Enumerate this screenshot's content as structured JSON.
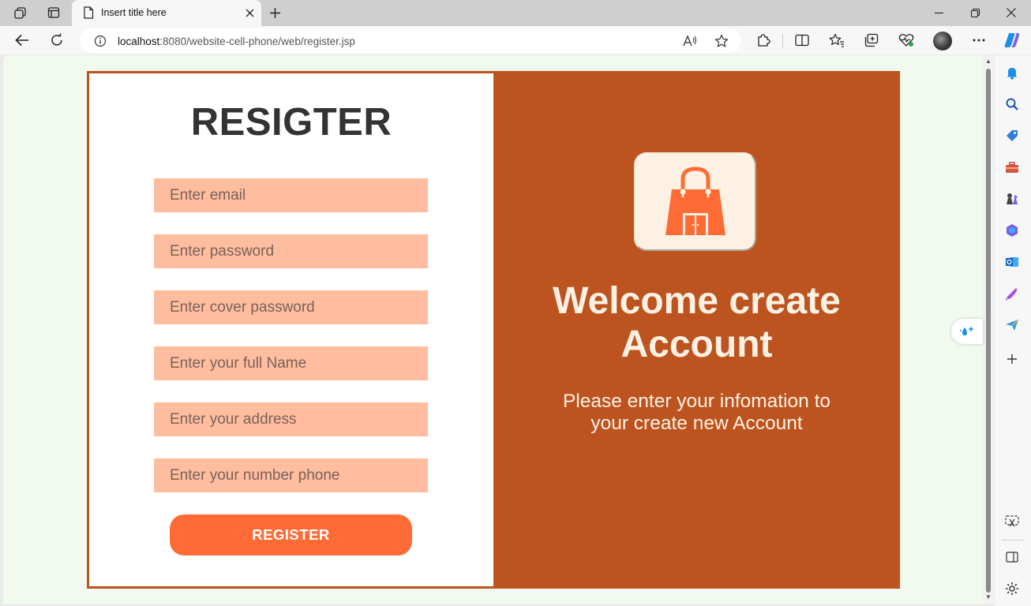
{
  "browser": {
    "tab_title": "Insert title here",
    "url_host": "localhost",
    "url_rest": ":8080/website-cell-phone/web/register.jsp",
    "icons": {
      "workspaces": "workspaces-icon",
      "tab_actions": "tab-actions-icon",
      "page": "page-icon",
      "close": "close-icon",
      "new_tab": "plus-icon",
      "minimize": "minimize-icon",
      "restore": "restore-icon",
      "window_close": "close-icon",
      "back": "back-arrow-icon",
      "refresh": "refresh-icon",
      "site_info": "info-icon",
      "read_aloud": "read-aloud-icon",
      "favorite": "star-icon",
      "extensions": "puzzle-icon",
      "split_screen": "split-screen-icon",
      "favorites": "favorites-icon",
      "collections": "collections-icon",
      "browser_essentials": "heart-pulse-icon",
      "more": "more-icon",
      "copilot": "copilot-icon"
    },
    "sidebar_icons": [
      "bell-icon",
      "search-icon",
      "tag-icon",
      "toolbox-icon",
      "chess-icon",
      "office-icon",
      "outlook-icon",
      "designer-icon",
      "send-icon",
      "plus-icon",
      "screenshot-icon",
      "sidebar-toggle-icon",
      "settings-icon"
    ]
  },
  "form": {
    "title": "RESIGTER",
    "fields": [
      {
        "placeholder": "Enter email"
      },
      {
        "placeholder": "Enter password"
      },
      {
        "placeholder": "Enter cover password"
      },
      {
        "placeholder": "Enter your full Name"
      },
      {
        "placeholder": "Enter your address"
      },
      {
        "placeholder": "Enter your number phone"
      }
    ],
    "submit_label": "REGISTER"
  },
  "welcome": {
    "logo_icon": "shopping-bag-icon",
    "title_line1": "Welcome create",
    "title_line2": "Account",
    "subtitle_line1": "Please enter your infomation to",
    "subtitle_line2": "your create new Account"
  },
  "colors": {
    "brand_orange": "#bd541f",
    "button_orange": "#ff6b35",
    "field_bg": "#ffbda0",
    "cream": "#fdf1e3",
    "page_bg": "#f2f9ee"
  }
}
